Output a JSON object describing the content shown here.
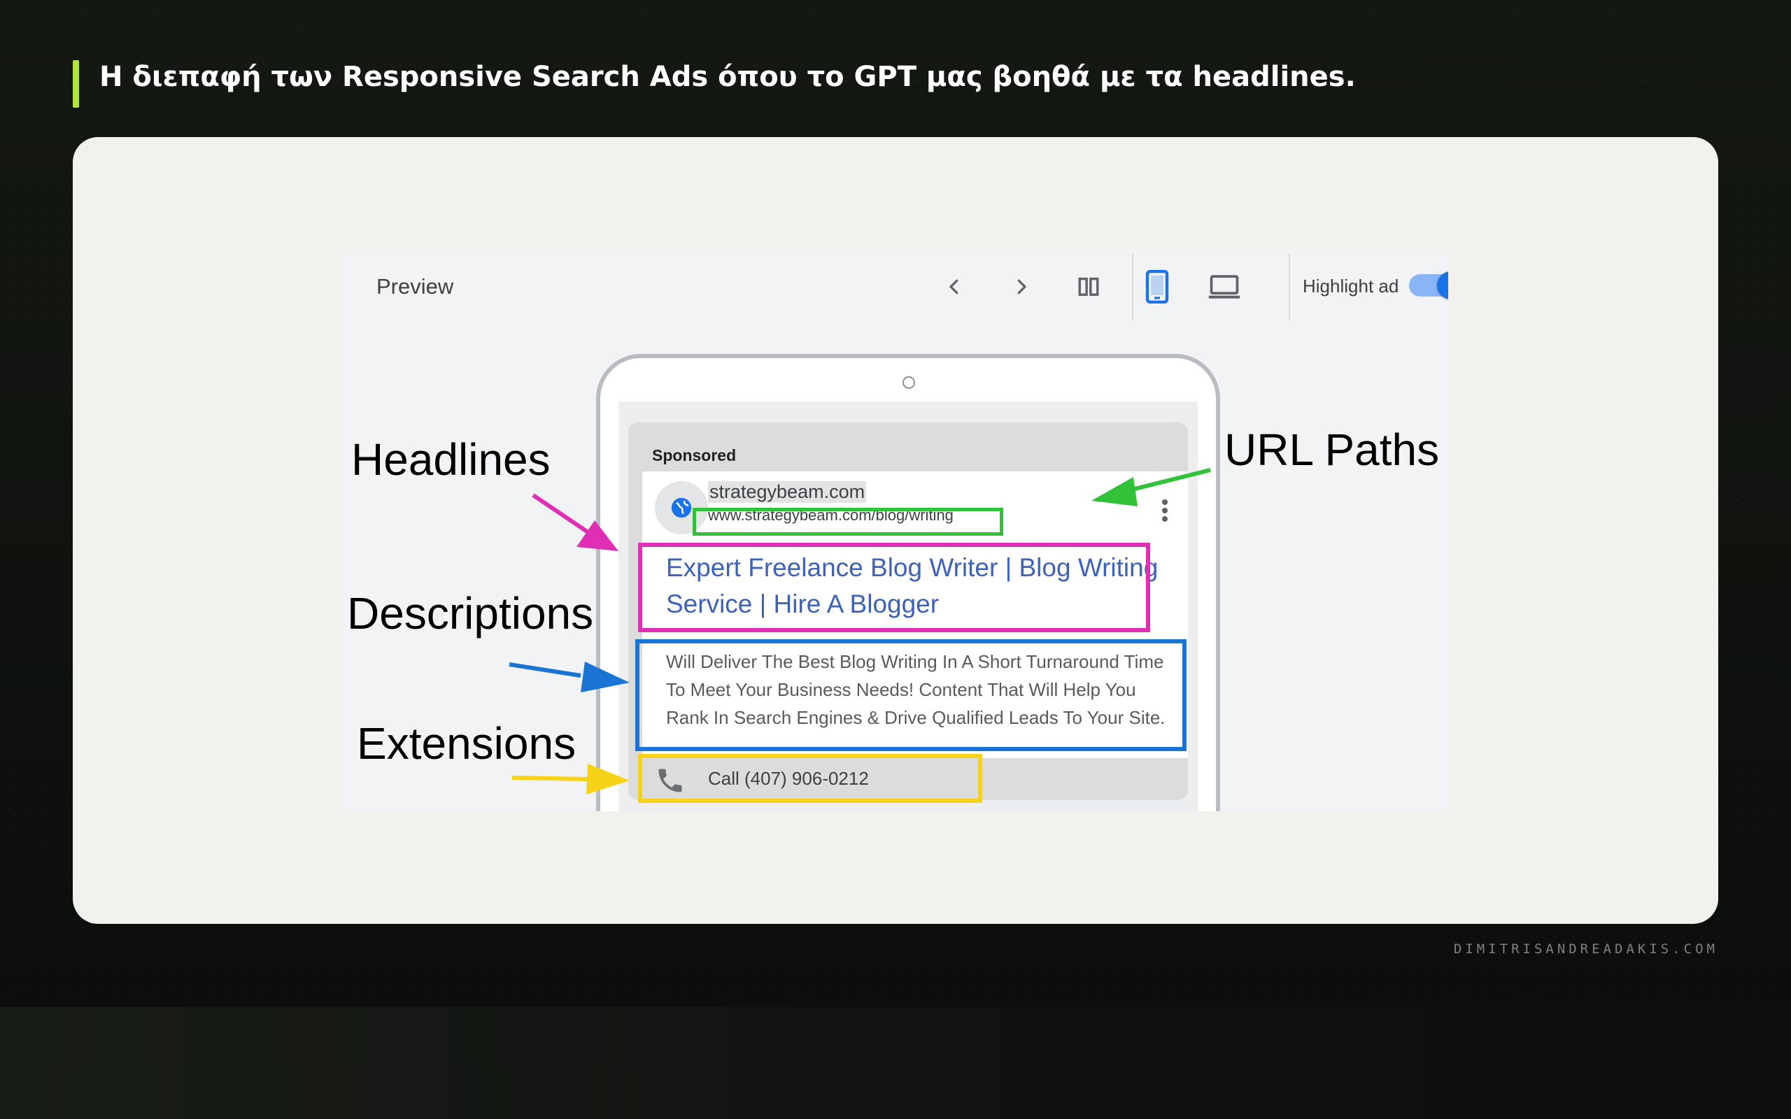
{
  "page": {
    "title": "Η διεπαφή των Responsive Search Ads όπου το GPT μας βοηθά με τα headlines.",
    "footer": "DIMITRISANDREADAKIS.COM"
  },
  "preview": {
    "toolbar": {
      "label": "Preview",
      "prev_icon": "chevron-left-icon",
      "next_icon": "chevron-right-icon",
      "columns_icon": "columns-icon",
      "mobile_icon": "mobile-icon",
      "desktop_icon": "laptop-icon",
      "highlight_label": "Highlight ad",
      "highlight_on": true
    },
    "ad": {
      "sponsored": "Sponsored",
      "domain": "strategybeam.com",
      "display_url": "www.strategybeam.com/blog/writing",
      "headline": "Expert Freelance Blog Writer | Blog Writing Service | Hire A Blogger",
      "description": "Will Deliver The Best Blog Writing In A Short Turnaround Time To Meet Your Business Needs! Content That Will Help You Rank In Search Engines & Drive Qualified Leads To Your Site.",
      "call_extension": "Call (407) 906-0212"
    },
    "annotations": {
      "headlines": "Headlines",
      "url_paths": "URL Paths",
      "descriptions": "Descriptions",
      "extensions": "Extensions"
    },
    "colors": {
      "headlines": "#e12fb5",
      "url_paths": "#32c23a",
      "descriptions": "#1a74d4",
      "extensions": "#f6d218",
      "headline_text": "#3d62b8",
      "accent_bar": "#b4e33c"
    }
  }
}
